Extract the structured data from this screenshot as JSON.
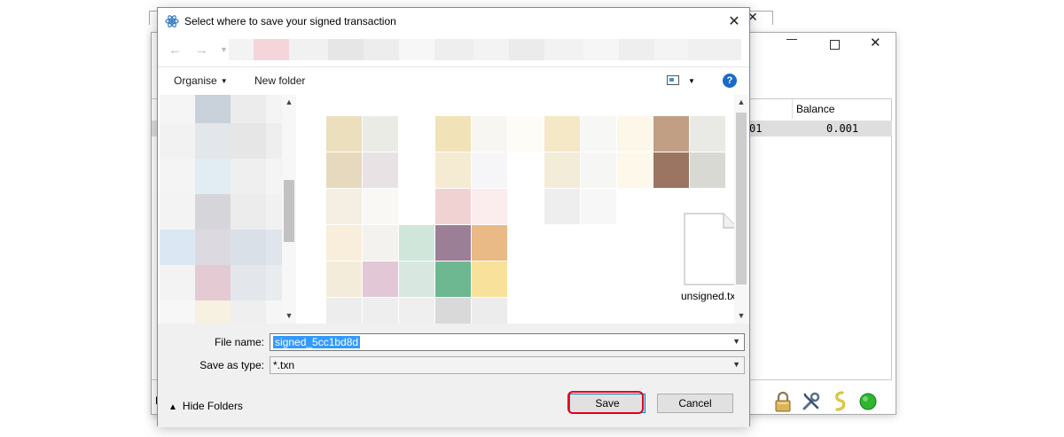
{
  "dialog": {
    "title": "Select where to save your signed transaction",
    "close_glyph": "✕",
    "toolbar": {
      "organise_label": "Organise",
      "new_folder_label": "New folder",
      "help_glyph": "?"
    },
    "file": {
      "name": "unsigned.txn"
    },
    "file_name_label": "File name:",
    "file_name_value": "signed_5cc1bd8d",
    "save_as_type_label": "Save as type:",
    "save_as_type_value": "*.txn",
    "hide_folders_label": "Hide Folders",
    "save_label": "Save",
    "cancel_label": "Cancel"
  },
  "background_window": {
    "table": {
      "columns": [
        "Balance"
      ],
      "row_partial_text": "01",
      "row_balance": "0.001"
    },
    "footer_letter": "E"
  },
  "colors": {
    "accent": "#0078d7",
    "highlight": "#e0001b",
    "selection": "#3399ff"
  }
}
